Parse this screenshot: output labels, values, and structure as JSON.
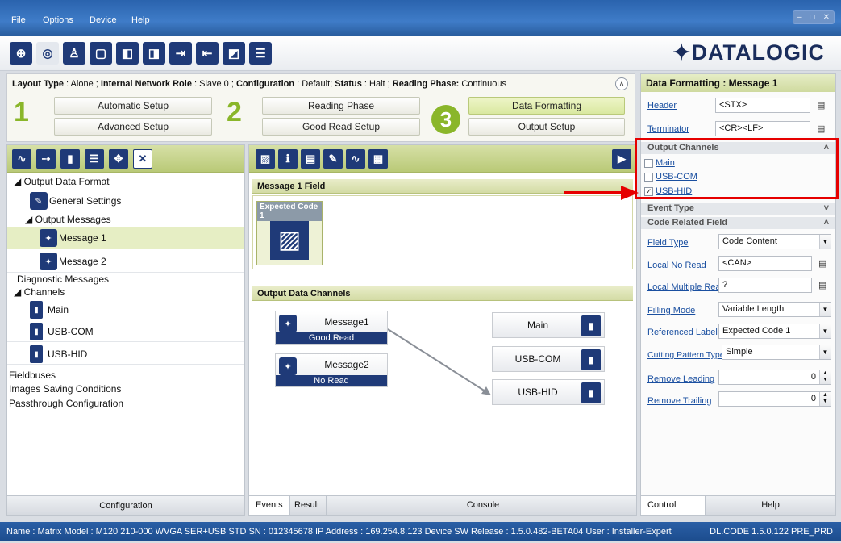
{
  "menu": {
    "file": "File",
    "options": "Options",
    "device": "Device",
    "help": "Help"
  },
  "brand": {
    "logo": "✦DATALOGIC"
  },
  "info": {
    "layout_type_label": "Layout Type",
    "layout_type": "Alone",
    "network_role_label": "Internal Network Role",
    "network_role": "Slave 0",
    "configuration_label": "Configuration",
    "configuration": "Default",
    "status_label": "Status",
    "status": "Halt",
    "reading_phase_label": "Reading Phase:",
    "reading_phase": "Continuous"
  },
  "wizard": {
    "step1": "1",
    "step2": "2",
    "step3": "3",
    "automatic_setup": "Automatic Setup",
    "advanced_setup": "Advanced Setup",
    "reading_phase": "Reading Phase",
    "good_read_setup": "Good Read Setup",
    "data_formatting": "Data Formatting",
    "output_setup": "Output Setup"
  },
  "tree": {
    "output_data_format": "Output Data Format",
    "general_settings": "General Settings",
    "output_messages": "Output Messages",
    "message1": "Message 1",
    "message2": "Message 2",
    "diagnostic_messages": "Diagnostic Messages",
    "channels": "Channels",
    "main": "Main",
    "usb_com": "USB-COM",
    "usb_hid": "USB-HID",
    "fieldbuses": "Fieldbuses",
    "images_saving": "Images Saving Conditions",
    "passthrough": "Passthrough Configuration",
    "footer": "Configuration"
  },
  "center": {
    "message_field_title": "Message 1 Field",
    "expected_code": "Expected Code 1",
    "output_channels_title": "Output Data Channels",
    "messages": [
      {
        "name": "Message1",
        "status": "Good Read"
      },
      {
        "name": "Message2",
        "status": "No Read"
      }
    ],
    "channels": [
      "Main",
      "USB-COM",
      "USB-HID"
    ],
    "tabs": {
      "events": "Events",
      "result": "Result",
      "console": "Console"
    }
  },
  "right": {
    "title": "Data Formatting : Message 1",
    "header_label": "Header",
    "header_value": "<STX>",
    "terminator_label": "Terminator",
    "terminator_value": "<CR><LF>",
    "output_channels": "Output Channels",
    "ch_main": "Main",
    "ch_usbcom": "USB-COM",
    "ch_usbhid": "USB-HID",
    "ch_main_checked": false,
    "ch_usbcom_checked": false,
    "ch_usbhid_checked": true,
    "event_type": "Event Type",
    "code_related_field": "Code Related Field",
    "field_type_label": "Field Type",
    "field_type": "Code Content",
    "local_no_read_label": "Local No Read",
    "local_no_read": "<CAN>",
    "local_multi_label": "Local Multiple Read",
    "local_multi": "?",
    "filling_mode_label": "Filling Mode",
    "filling_mode": "Variable Length",
    "ref_label_label": "Referenced Label",
    "ref_label": "Expected Code  1",
    "cutting_label": "Cutting Pattern Type",
    "cutting": "Simple",
    "remove_leading_label": "Remove Leading",
    "remove_leading": "0",
    "remove_trailing_label": "Remove Trailing",
    "remove_trailing": "0",
    "tab_control": "Control",
    "tab_help": "Help"
  },
  "statusbar": {
    "text": "Name : Matrix  Model : M120 210-000 WVGA SER+USB STD   SN : 012345678   IP Address :  169.254.8.123   Device SW Release : 1.5.0.482-BETA04   User : Installer-Expert",
    "version": "DL.CODE 1.5.0.122 PRE_PRD"
  },
  "colors": {
    "accent": "#8ab62a",
    "navy": "#1f3a78",
    "highlight": "#e60000"
  }
}
